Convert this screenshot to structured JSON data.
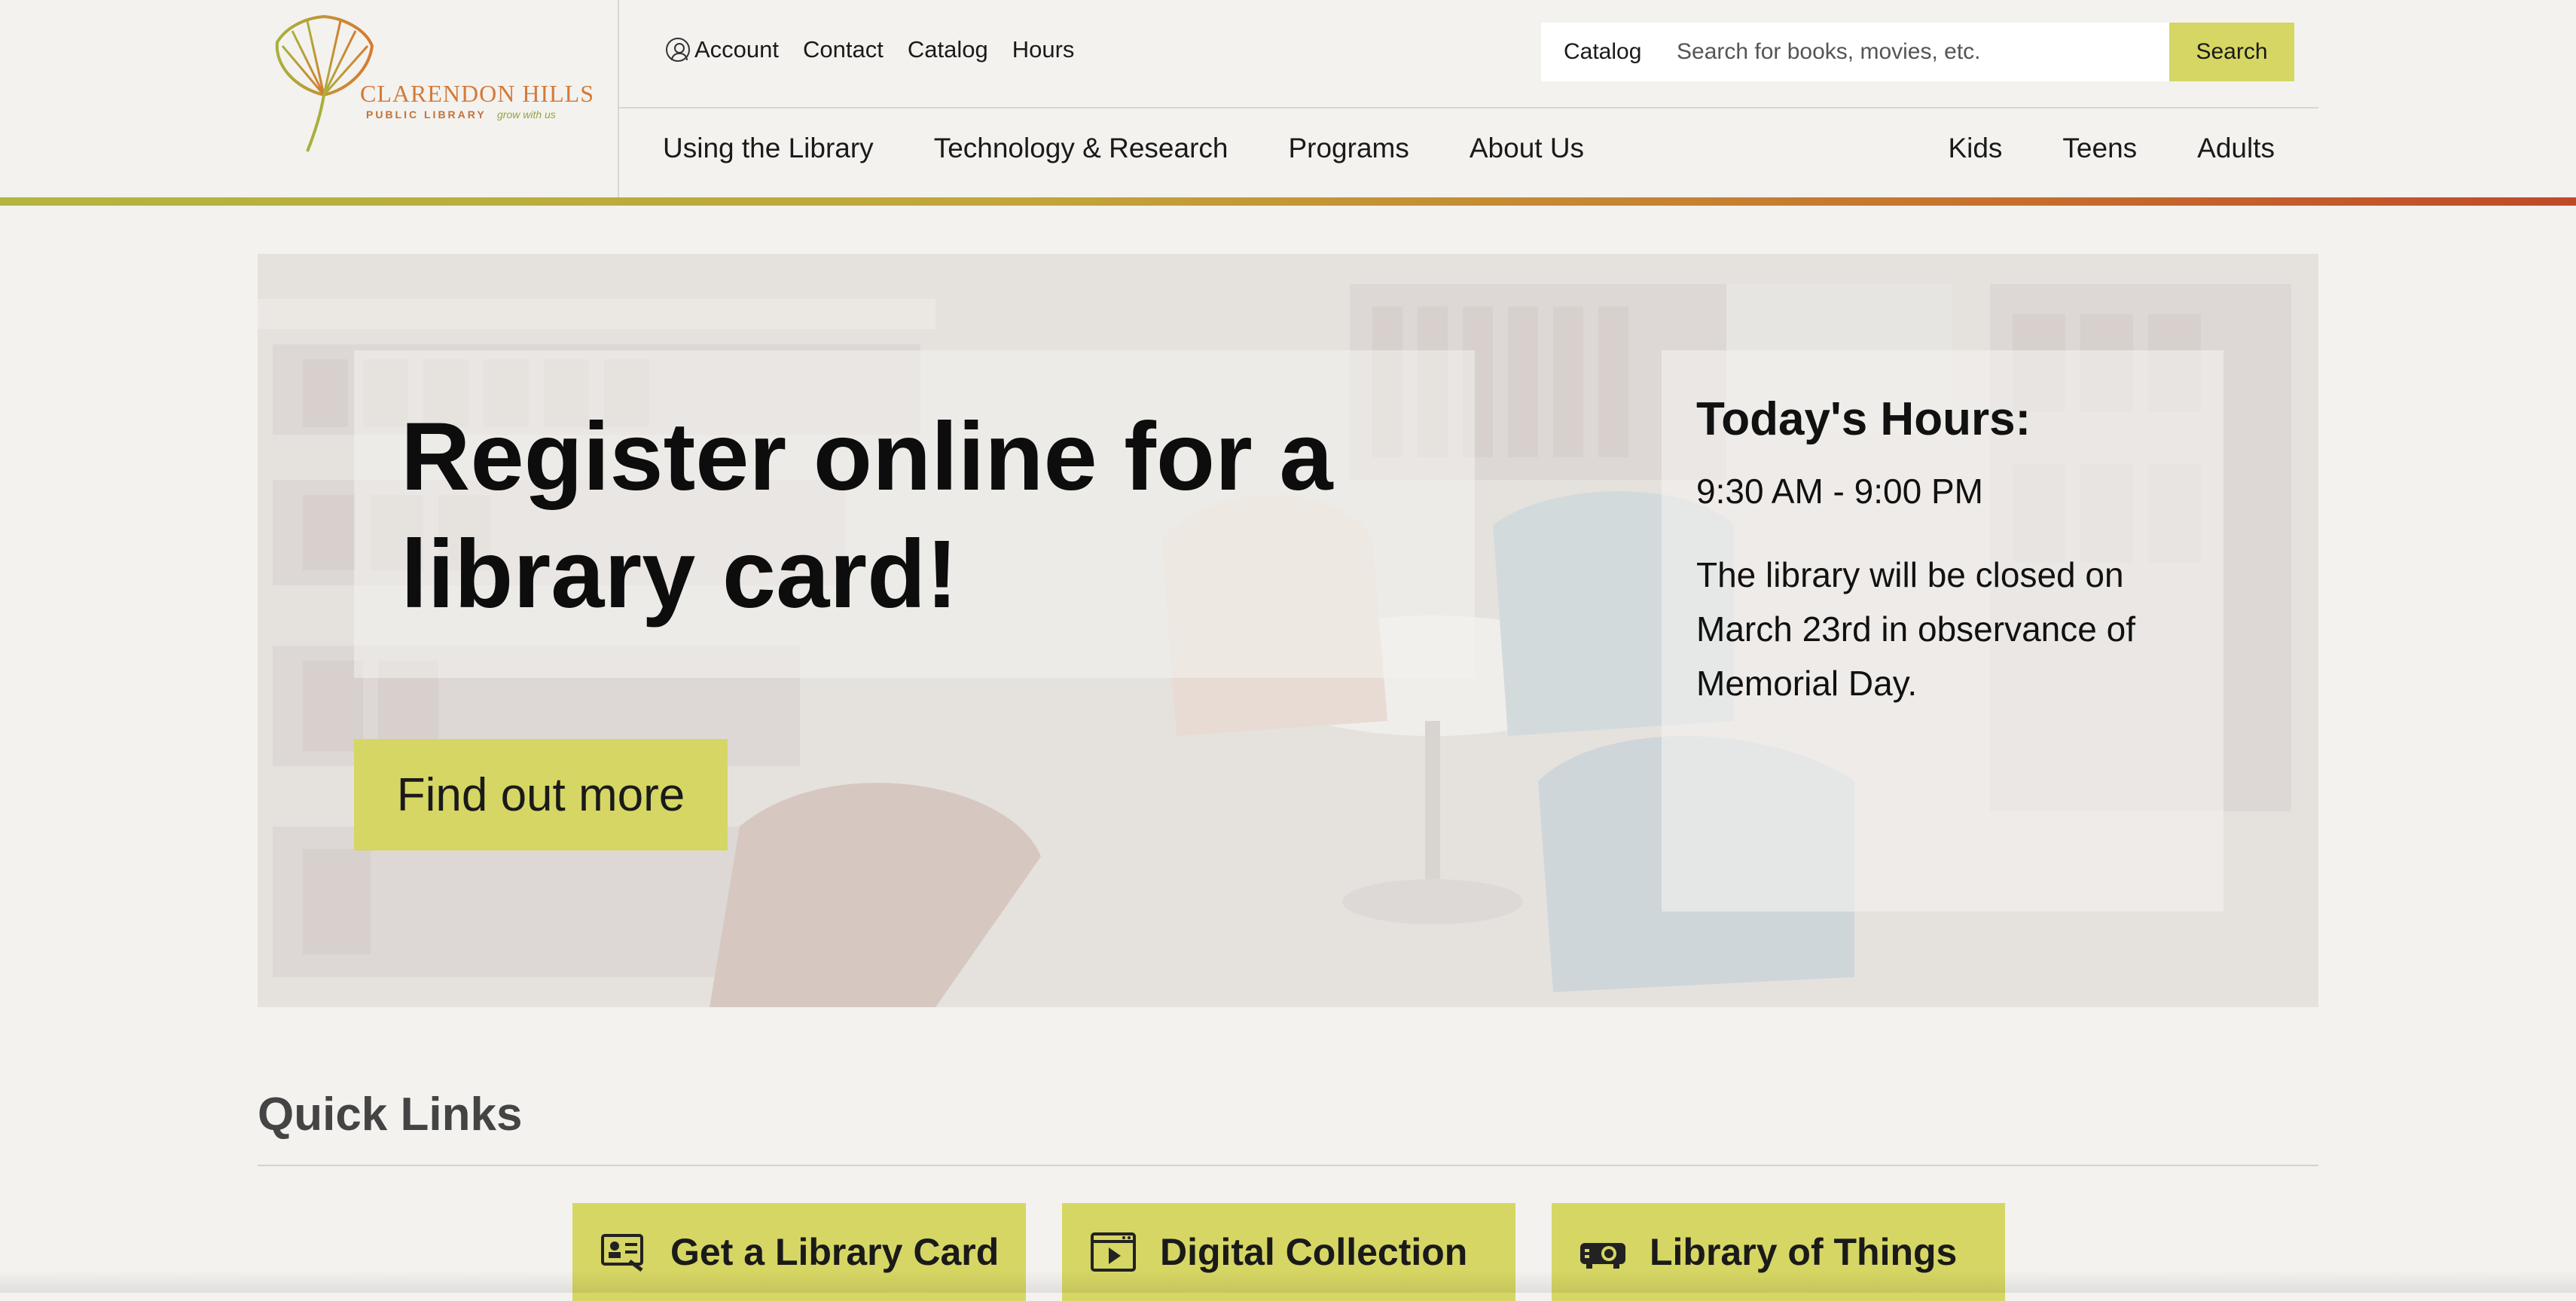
{
  "logo": {
    "name": "CLARENDON HILLS",
    "sub": "PUBLIC LIBRARY",
    "tagline": "grow with us"
  },
  "util_nav": {
    "account": "Account",
    "contact": "Contact",
    "catalog": "Catalog",
    "hours": "Hours"
  },
  "search": {
    "scope": "Catalog",
    "placeholder": "Search for books, movies, etc.",
    "button": "Search"
  },
  "main_nav": [
    "Using the Library",
    "Technology & Research",
    "Programs",
    "About Us"
  ],
  "audience_nav": [
    "Kids",
    "Teens",
    "Adults"
  ],
  "hero": {
    "title": "Register online for a library card!",
    "cta": "Find out more"
  },
  "hours": {
    "title": "Today's Hours:",
    "time": "9:30 AM - 9:00 PM",
    "note": "The library will be closed on March 23rd in observance of Memorial Day."
  },
  "quick_links": {
    "title": "Quick Links",
    "items": [
      {
        "label": "Get a Library Card",
        "icon": "library-card-icon"
      },
      {
        "label": "Digital Collection",
        "icon": "video-player-icon"
      },
      {
        "label": "Library of Things",
        "icon": "projector-icon"
      }
    ]
  },
  "colors": {
    "accent": "#d6d664",
    "background": "#f3f2ef",
    "logo_orange": "#d47a3a",
    "logo_green": "#9aa33e"
  }
}
